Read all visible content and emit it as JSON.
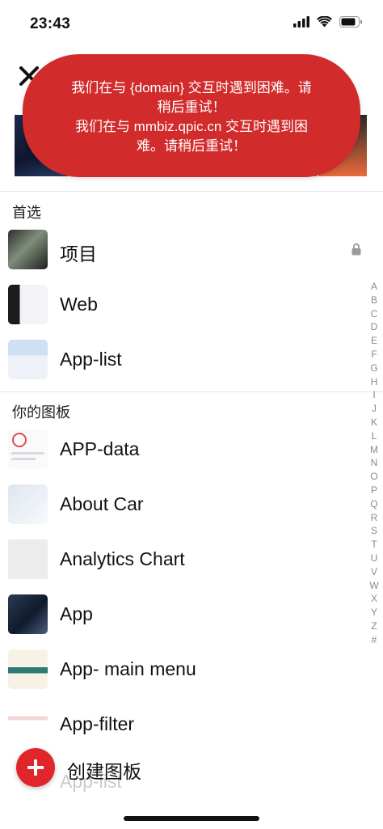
{
  "status_bar": {
    "time": "23:43"
  },
  "toast": {
    "line1": "我们在与 {domain} 交互时遇到困难。请",
    "line2": "稍后重试！",
    "line3": "我们在与 mmbiz.qpic.cn 交互时遇到困",
    "line4": "难。请稍后重试！"
  },
  "sections": {
    "preferred_title": "首选",
    "boards_title": "你的图板"
  },
  "preferred": [
    {
      "label": "项目",
      "locked": true
    },
    {
      "label": "Web"
    },
    {
      "label": "App-list"
    }
  ],
  "boards": [
    {
      "label": "APP-data"
    },
    {
      "label": "About Car"
    },
    {
      "label": "Analytics Chart"
    },
    {
      "label": "App"
    },
    {
      "label": "App- main menu"
    },
    {
      "label": "App-filter"
    }
  ],
  "ghost_row": {
    "label": "App-list"
  },
  "index_letters": [
    "A",
    "B",
    "C",
    "D",
    "E",
    "F",
    "G",
    "H",
    "I",
    "J",
    "K",
    "L",
    "M",
    "N",
    "O",
    "P",
    "Q",
    "R",
    "S",
    "T",
    "U",
    "V",
    "W",
    "X",
    "Y",
    "Z",
    "#"
  ],
  "create": {
    "label": "创建图板"
  },
  "colors": {
    "toast_bg": "#d22b2b",
    "fab": "#e0262b"
  }
}
